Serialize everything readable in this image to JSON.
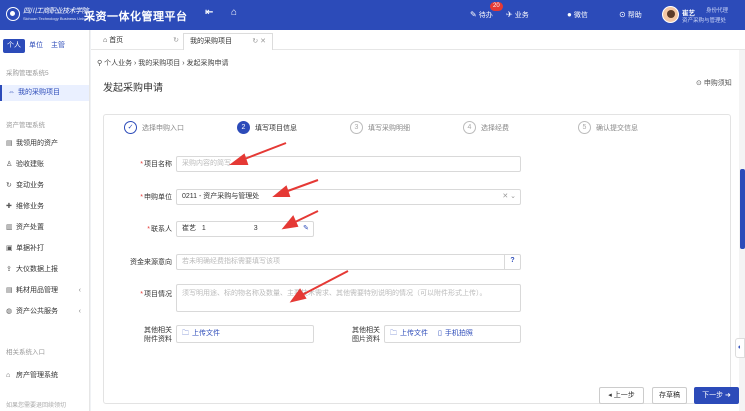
{
  "header": {
    "logo_line1": "四川工商职业技术学院",
    "logo_line2": "Sichuan Technology Business University",
    "title": "采资一体化管理平台",
    "collapse_icon": "collapse-icon",
    "home_icon": "home-icon",
    "todo_label": "待办",
    "todo_count": "20",
    "business_label": "业务",
    "wechat_label": "微信",
    "help_label": "帮助",
    "user_name": "崔艺",
    "user_role_label": "身份代理",
    "user_dept": "资产采购与管理处"
  },
  "sidebar": {
    "tabs": [
      "个人",
      "单位",
      "主管"
    ],
    "active_tab": "个人",
    "group1": "采购管理系统5",
    "group1_items": [
      {
        "label": "我的采购项目",
        "icon": "expand-icon"
      }
    ],
    "group2": "资产管理系统",
    "group2_items": [
      {
        "label": "我领用的资产",
        "icon": "list-icon"
      },
      {
        "label": "验收建账",
        "icon": "thumb-icon"
      },
      {
        "label": "变动业务",
        "icon": "refresh-icon"
      },
      {
        "label": "维修业务",
        "icon": "wrench-icon"
      },
      {
        "label": "资产处置",
        "icon": "trash-icon"
      },
      {
        "label": "单据补打",
        "icon": "print-icon"
      },
      {
        "label": "大仪数据上报",
        "icon": "upload-icon"
      },
      {
        "label": "耗材用品管理",
        "icon": "list-icon"
      },
      {
        "label": "资产公共服务",
        "icon": "globe-icon"
      }
    ],
    "group3": "相关系统入口",
    "group3_items": [
      {
        "label": "房产管理系统",
        "icon": "house-icon"
      }
    ],
    "footer_text": "如果您需要退回续领切"
  },
  "tabs": {
    "home": "首页",
    "current": "我的采购项目"
  },
  "breadcrumb": "个人业务 › 我的采购项目 › 发起采购申请",
  "page_title": "发起采购申请",
  "help_link": "申购须知",
  "steps": [
    {
      "num": "✓",
      "label": "选择申购入口",
      "state": "done"
    },
    {
      "num": "2",
      "label": "填写项目信息",
      "state": "current"
    },
    {
      "num": "3",
      "label": "填写采购明细",
      "state": "todo"
    },
    {
      "num": "4",
      "label": "选择经费",
      "state": "todo"
    },
    {
      "num": "5",
      "label": "确认提交信息",
      "state": "todo"
    }
  ],
  "form": {
    "project_name_label": "项目名称",
    "project_name_placeholder": "采购内容的简写",
    "unit_label": "申购单位",
    "unit_value": "0211 - 资产采购与管理处",
    "contact_label": "联系人",
    "contact_name": "崔艺",
    "contact_phone_start": "1",
    "contact_phone_end": "3",
    "fund_label": "资金来源意向",
    "fund_placeholder": "若未明确经费指标需要填写该项",
    "fund_help": "?",
    "desc_label": "项目情况",
    "desc_placeholder": "须写明用途、标的物名称及数量、主要技术需求、其他需要特别说明的情况（可以附件形式上传）。",
    "attach1_label_a": "其他相关",
    "attach1_label_b": "附件资料",
    "attach1_button": "上传文件",
    "attach2_label_a": "其他相关",
    "attach2_label_b": "图片资料",
    "attach2_button": "上传文件",
    "attach2_phone": "手机拍照"
  },
  "buttons": {
    "prev": "◂ 上一步",
    "draft": "存草稿",
    "next": "下一步 ➜"
  },
  "colors": {
    "primary": "#2c4bb9",
    "annotation": "#e53935"
  }
}
